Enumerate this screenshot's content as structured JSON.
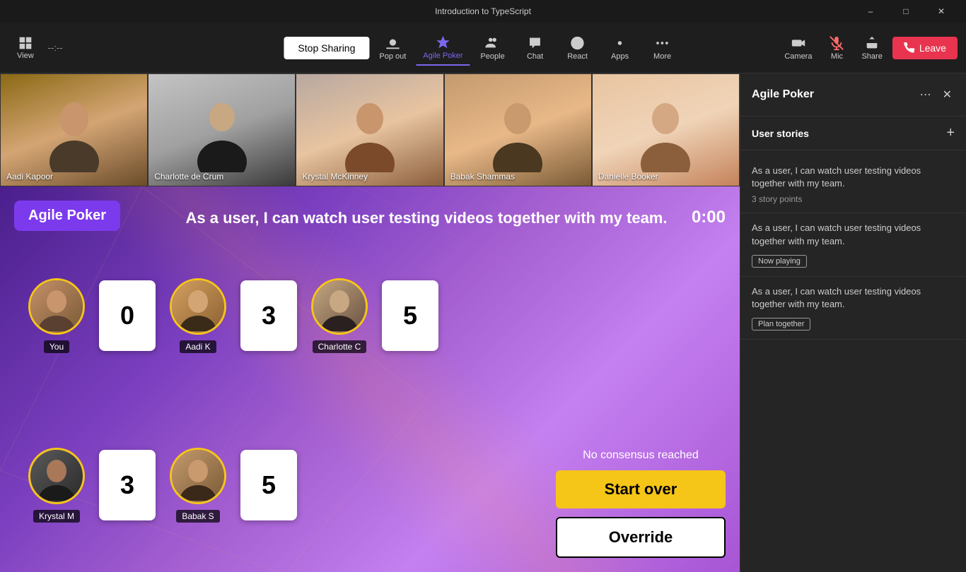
{
  "window": {
    "title": "Introduction to TypeScript",
    "controls": [
      "minimize",
      "maximize",
      "close"
    ]
  },
  "toolbar": {
    "view_label": "View",
    "timer_label": "--:--",
    "stop_sharing_label": "Stop Sharing",
    "pop_out_label": "Pop out",
    "agile_poker_label": "Agile Poker",
    "people_label": "People",
    "chat_label": "Chat",
    "react_label": "React",
    "apps_label": "Apps",
    "more_label": "More",
    "camera_label": "Camera",
    "mic_label": "Mic",
    "share_label": "Share",
    "leave_label": "Leave"
  },
  "video_strip": {
    "participants": [
      {
        "name": "Aadi Kapoor",
        "bg": "#6b4c2a"
      },
      {
        "name": "Charlotte de Crum",
        "bg": "#3a3a3a"
      },
      {
        "name": "Krystal McKinney",
        "bg": "#8B5E3C"
      },
      {
        "name": "Babak Shammas",
        "bg": "#7a5a35"
      },
      {
        "name": "Danielle Booker",
        "bg": "#c4825a"
      }
    ]
  },
  "game": {
    "title": "Agile Poker",
    "question": "As a user, I can watch user testing videos together with my team.",
    "timer": "0:00",
    "players_row1": [
      {
        "name": "You",
        "card": "0",
        "avatar_bg": "#b8860b"
      },
      {
        "name": "Aadi K",
        "card": "3",
        "avatar_bg": "#c4a060"
      },
      {
        "name": "Charlotte C",
        "card": "5",
        "avatar_bg": "#8B7355"
      }
    ],
    "players_row2": [
      {
        "name": "Krystal M",
        "card": "3",
        "avatar_bg": "#4a4a4a"
      },
      {
        "name": "Babak S",
        "card": "5",
        "avatar_bg": "#7a5a35"
      }
    ],
    "no_consensus_text": "No consensus reached",
    "start_over_label": "Start over",
    "override_label": "Override"
  },
  "sidebar": {
    "panel_title": "Agile Poker",
    "user_stories_title": "User stories",
    "stories": [
      {
        "text": "As a user, I can watch user testing videos together with my team.",
        "points": "3 story points",
        "badge": null
      },
      {
        "text": "As a user, I can watch user testing videos together with my team.",
        "points": null,
        "badge": "Now playing"
      },
      {
        "text": "As a user, I can watch user testing videos together with my team.",
        "points": null,
        "badge": "Plan together"
      }
    ]
  }
}
